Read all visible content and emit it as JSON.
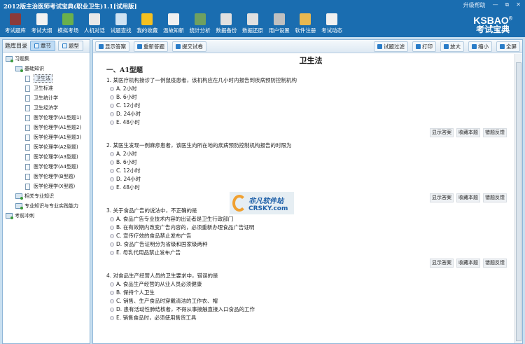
{
  "window": {
    "title": "2012版主治医师考试宝典(职业卫生)1.1[试用版]",
    "help": "升级帮助",
    "min": "—",
    "restore": "⧉",
    "close": "✕"
  },
  "toolbar": [
    {
      "label": "考试题库",
      "icon": "book-icon",
      "color": "#8b3a3a"
    },
    {
      "label": "考试大纲",
      "icon": "document-icon",
      "color": "#f2f2f2"
    },
    {
      "label": "模拟考场",
      "icon": "pencil-icon",
      "color": "#6ab04c"
    },
    {
      "label": "人机对话",
      "icon": "chat-icon",
      "color": "#e8e8e8"
    },
    {
      "label": "试题查找",
      "icon": "search-icon",
      "color": "#cfe3f3"
    },
    {
      "label": "我的收藏",
      "icon": "star-icon",
      "color": "#f5c020"
    },
    {
      "label": "温故知新",
      "icon": "bulb-icon",
      "color": "#f0f0f0"
    },
    {
      "label": "统计分析",
      "icon": "chart-icon",
      "color": "#6fa060"
    },
    {
      "label": "数据备份",
      "icon": "backup-icon",
      "color": "#e0e0e0"
    },
    {
      "label": "数据还原",
      "icon": "restore-icon",
      "color": "#e0e0e0"
    },
    {
      "label": "用户设置",
      "icon": "hammer-icon",
      "color": "#c0c0c0"
    },
    {
      "label": "软件注册",
      "icon": "lock-icon",
      "color": "#e8b850"
    },
    {
      "label": "考试动态",
      "icon": "news-icon",
      "color": "#f0f0f0"
    }
  ],
  "logo": {
    "en": "KSBAO",
    "reg": "®",
    "cn": "考试宝典"
  },
  "left": {
    "title": "题库目录",
    "tab_chapter": "章节",
    "tab_type": "题型",
    "root": "习题集",
    "group": "基础知识",
    "items": [
      "卫生法",
      "卫生标准",
      "卫生统计学",
      "卫生经济学",
      "医学伦理学(A1型题1)",
      "医学伦理学(A1型题2)",
      "医学伦理学(A1型题3)",
      "医学伦理学(A2型题)",
      "医学伦理学(A3型题)",
      "医学伦理学(A4型题)",
      "医学伦理学(B型题)",
      "医学伦理学(X型题)"
    ],
    "group2": "相关专业知识",
    "group3": "专业知识与专业实践能力",
    "root2": "考前冲刺"
  },
  "rtool": {
    "show": "显示答案",
    "redo": "重新答题",
    "submit": "提交试卷",
    "filter": "试题过滤",
    "print": "打印",
    "zoomin": "放大",
    "zoomout": "缩小",
    "full": "全屏"
  },
  "content": {
    "title": "卫生法",
    "section": "一、A1型题",
    "actions": {
      "show": "显示答案",
      "fav": "收藏本题",
      "report": "错题反馈"
    },
    "questions": [
      {
        "q": "1. 某医疗机构接诊了一例鼠疫患者，该机构应在几小时内报告到疾病预防控制机构",
        "options": [
          "A. 2小时",
          "B. 6小时",
          "C. 12小时",
          "D. 24小时",
          "E. 48小时"
        ]
      },
      {
        "q": "2. 某医生发现一例麻疹患者，该医生向所在地的疾病预防控制机构报告的时限为",
        "options": [
          "A. 2小时",
          "B. 6小时",
          "C. 12小时",
          "D. 24小时",
          "E. 48小时"
        ]
      },
      {
        "q": "3. 关于食品广告的说法中，不正确的是",
        "options": [
          "A. 食品广告专业技术内容的出证者是卫生行政部门",
          "B. 在有效期内改变广告内容的，必须重新办理食品广告证明",
          "C. 宣传疗效的食品禁止发布广告",
          "D. 食品广告证明分为省级和国家级两种",
          "E. 母乳代用品禁止发布广告"
        ]
      },
      {
        "q": "4. 对食品生产经营人员的卫生要求中，错误的是",
        "options": [
          "A. 食品生产经营的从业人员必须健康",
          "B. 保持个人卫生",
          "C. 销售、生产食品时穿戴清洁的工作衣、帽",
          "D. 患有活动性肺结核者，不得从事接触直接入口食品的工作",
          "E. 销售食品时，必须使用售货工具"
        ]
      }
    ]
  },
  "watermark": {
    "cn": "非凡软件站",
    "en": "CRSKY.com"
  }
}
